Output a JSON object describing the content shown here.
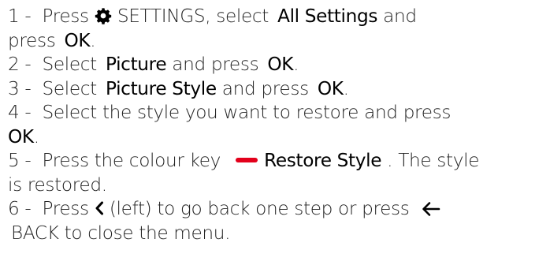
{
  "steps": {
    "s1": {
      "num": "1 -",
      "press": "Press",
      "icon": "gear-icon",
      "settings": "SETTINGS, select",
      "all_settings": "All Settings",
      "and": "and",
      "press2": "press",
      "ok": "OK",
      "end": "."
    },
    "s2": {
      "num": "2 -",
      "select": "Select",
      "picture": "Picture",
      "and_press": "and press",
      "ok": "OK",
      "end": "."
    },
    "s3": {
      "num": "3 -",
      "select": "Select",
      "picture_style": "Picture Style",
      "and_press": "and press",
      "ok": "OK",
      "end": "."
    },
    "s4": {
      "num": "4 -",
      "text": "Select the style you want to restore and press",
      "ok": "OK",
      "end": "."
    },
    "s5": {
      "num": "5 -",
      "text": "Press the colour key",
      "key_color": "#e3001b",
      "restore_style": "Restore Style",
      "after": ". The style",
      "rest": "is restored."
    },
    "s6": {
      "num": "6 -",
      "press": "Press",
      "left_icon": "chevron-left-icon",
      "left_text": "(left) to go back one step or press",
      "back_icon": "arrow-left-icon",
      "back_text": "BACK to close the menu."
    }
  }
}
